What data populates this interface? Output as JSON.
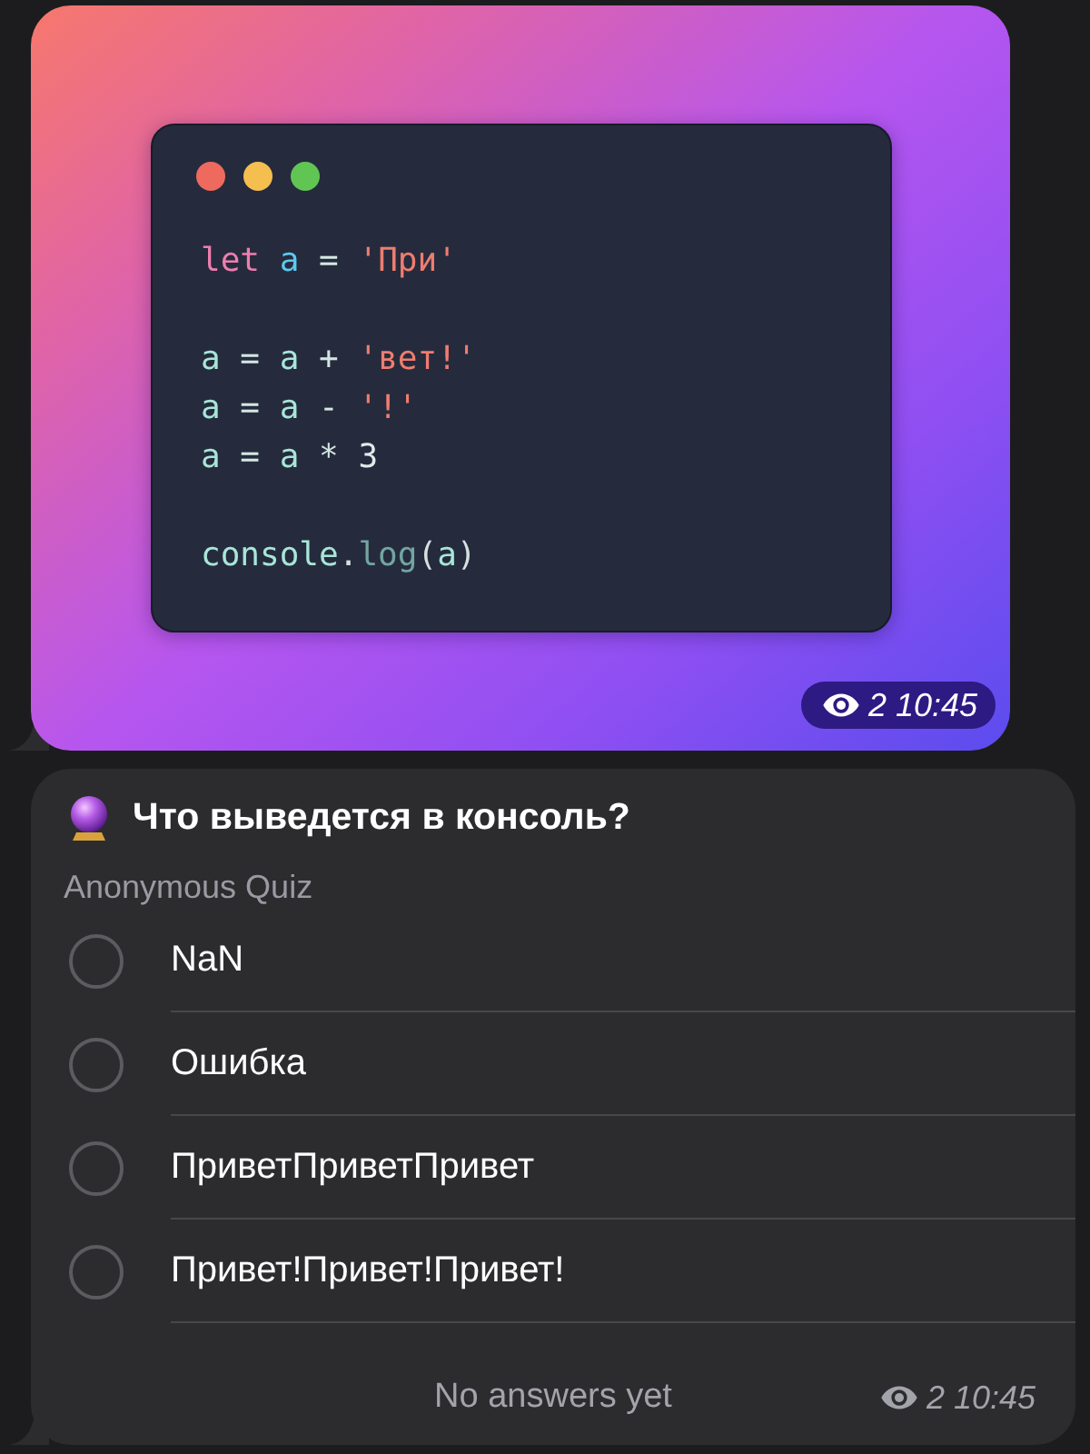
{
  "image_message": {
    "code_window": {
      "window_controls": [
        {
          "color": "#ee6a5f"
        },
        {
          "color": "#f4bf4f"
        },
        {
          "color": "#61c554"
        }
      ],
      "blocks": [
        {
          "lines": [
            [
              {
                "text": "let",
                "kind": "keyword"
              },
              {
                "text": " a",
                "kind": "definition"
              },
              {
                "text": " =",
                "kind": "operator"
              },
              {
                "text": " 'При'",
                "kind": "string"
              }
            ]
          ]
        },
        {
          "lines": [
            [
              {
                "text": "a",
                "kind": "variable"
              },
              {
                "text": " =",
                "kind": "operator"
              },
              {
                "text": " a",
                "kind": "variable"
              },
              {
                "text": " +",
                "kind": "operator"
              },
              {
                "text": " 'вет!'",
                "kind": "string"
              }
            ],
            [
              {
                "text": "a",
                "kind": "variable"
              },
              {
                "text": " =",
                "kind": "operator"
              },
              {
                "text": " a",
                "kind": "variable"
              },
              {
                "text": " -",
                "kind": "operator"
              },
              {
                "text": " '!'",
                "kind": "string"
              }
            ],
            [
              {
                "text": "a",
                "kind": "variable"
              },
              {
                "text": " =",
                "kind": "operator"
              },
              {
                "text": " a",
                "kind": "variable"
              },
              {
                "text": " *",
                "kind": "operator"
              },
              {
                "text": " 3",
                "kind": "number"
              }
            ]
          ]
        },
        {
          "lines": [
            [
              {
                "text": "console",
                "kind": "variable"
              },
              {
                "text": ".",
                "kind": "punctuation"
              },
              {
                "text": "log",
                "kind": "function"
              },
              {
                "text": "(",
                "kind": "punctuation"
              },
              {
                "text": "a",
                "kind": "variable"
              },
              {
                "text": ")",
                "kind": "punctuation"
              }
            ]
          ]
        }
      ]
    },
    "views": "2",
    "time": "10:45"
  },
  "poll": {
    "question": "Что выведется в консоль?",
    "subtitle": "Anonymous Quiz",
    "options": [
      {
        "text": "NaN",
        "selected": false
      },
      {
        "text": "Ошибка",
        "selected": false
      },
      {
        "text": "ПриветПриветПривет",
        "selected": false
      },
      {
        "text": "Привет!Привет!Привет!",
        "selected": false
      }
    ],
    "footer": "No answers yet",
    "views": "2",
    "time": "10:45"
  }
}
